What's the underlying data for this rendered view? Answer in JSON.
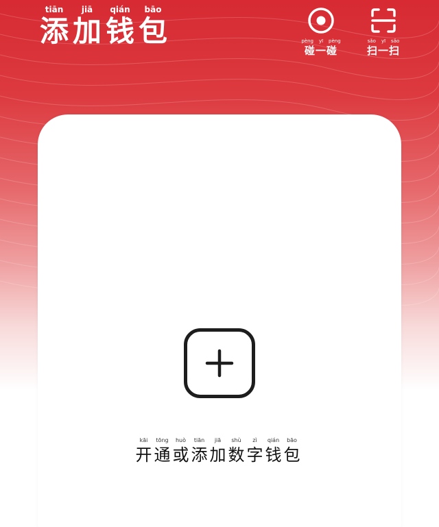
{
  "header": {
    "title_chars": [
      {
        "pinyin": "tiān",
        "char": "添"
      },
      {
        "pinyin": "jiā",
        "char": "加"
      },
      {
        "pinyin": "qián",
        "char": "钱"
      },
      {
        "pinyin": "bāo",
        "char": "包"
      }
    ],
    "bump": {
      "icon": "target-icon",
      "pinyin": [
        "pèng",
        "yī",
        "pèng"
      ],
      "label": "碰一碰"
    },
    "scan": {
      "icon": "scan-icon",
      "pinyin": [
        "sǎo",
        "yī",
        "sǎo"
      ],
      "label": "扫一扫"
    }
  },
  "card": {
    "add_icon": "plus-icon",
    "label_chars": [
      {
        "pinyin": "kāi",
        "char": "开"
      },
      {
        "pinyin": "tōng",
        "char": "通"
      },
      {
        "pinyin": "huò",
        "char": "或"
      },
      {
        "pinyin": "tiān",
        "char": "添"
      },
      {
        "pinyin": "jiā",
        "char": "加"
      },
      {
        "pinyin": "shù",
        "char": "数"
      },
      {
        "pinyin": "zì",
        "char": "字"
      },
      {
        "pinyin": "qián",
        "char": "钱"
      },
      {
        "pinyin": "bāo",
        "char": "包"
      }
    ]
  },
  "colors": {
    "brand_red": "#d72a33",
    "icon_dark": "#1d1d1d"
  }
}
